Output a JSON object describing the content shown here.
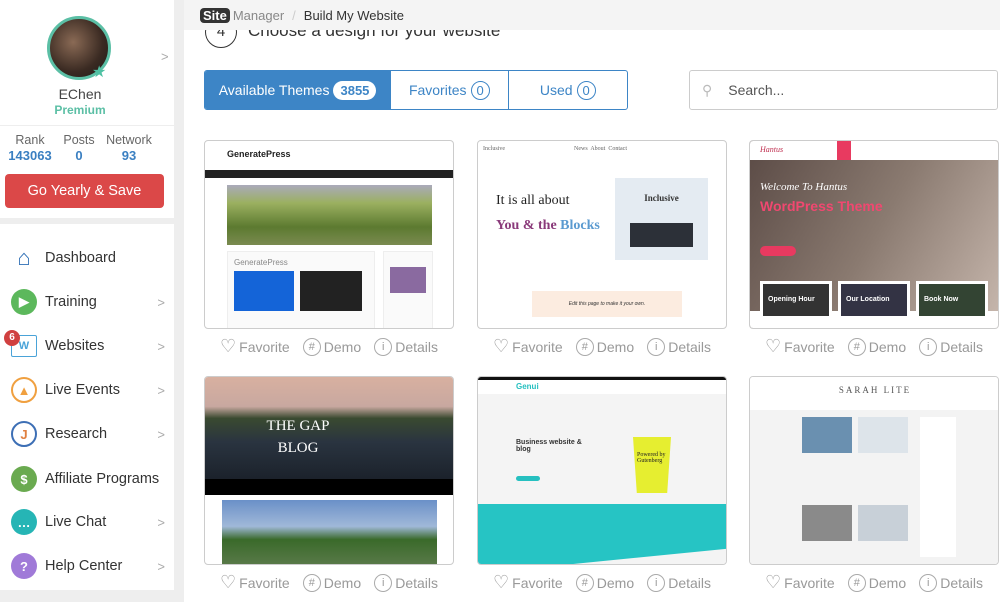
{
  "profile": {
    "name": "EChen",
    "plan": "Premium",
    "stats": [
      {
        "label": "Rank",
        "value": "143063"
      },
      {
        "label": "Posts",
        "value": "0"
      },
      {
        "label": "Network",
        "value": "93"
      }
    ],
    "cta": "Go Yearly & Save"
  },
  "menu": [
    {
      "label": "Dashboard",
      "icon": "home-icon",
      "color": "#2f6fb5"
    },
    {
      "label": "Training",
      "icon": "play-icon",
      "color": "#5cb85c"
    },
    {
      "label": "Websites",
      "icon": "website-icon",
      "color": "#4aa3d8",
      "badge": "6"
    },
    {
      "label": "Live Events",
      "icon": "broadcast-icon",
      "color": "#f0a040"
    },
    {
      "label": "Research",
      "icon": "research-icon",
      "color": "#3d6fb5"
    },
    {
      "label": "Affiliate Programs",
      "icon": "affiliate-icon",
      "color": "#6aaa50"
    },
    {
      "label": "Live Chat",
      "icon": "chat-icon",
      "color": "#26b5b5"
    },
    {
      "label": "Help Center",
      "icon": "help-icon",
      "color": "#a07ad8"
    }
  ],
  "breadcrumb": {
    "brand": "Site",
    "brand_suffix": "Manager",
    "current": "Build My Website"
  },
  "step": {
    "number": "4",
    "title": "Choose a design for your website"
  },
  "tabs": [
    {
      "label": "Available Themes",
      "count": "3855"
    },
    {
      "label": "Favorites",
      "count": "0"
    },
    {
      "label": "Used",
      "count": "0"
    }
  ],
  "search": {
    "placeholder": "Search..."
  },
  "actions": {
    "favorite": "Favorite",
    "demo": "Demo",
    "details": "Details"
  },
  "themes": [
    {
      "title": "GeneratePress",
      "sub": "GeneratePress"
    },
    {
      "title": "Inclusive",
      "line1": "It is all about",
      "line2a": "You & the",
      "line2b": "Blocks",
      "nav": "News  About  Contact",
      "cta": "Edit this page to make it your own."
    },
    {
      "title": "Hantus",
      "line1": "Welcome To Hantus",
      "line2": "WordPress Theme",
      "boxes": [
        "Opening Hour",
        "Our Location",
        "Book Now"
      ]
    },
    {
      "title": "THE GAP BLOG"
    },
    {
      "title": "Genui",
      "line1": "Business website & blog",
      "cup": "Powered by Gutenberg"
    },
    {
      "title": "SARAH LITE"
    }
  ]
}
